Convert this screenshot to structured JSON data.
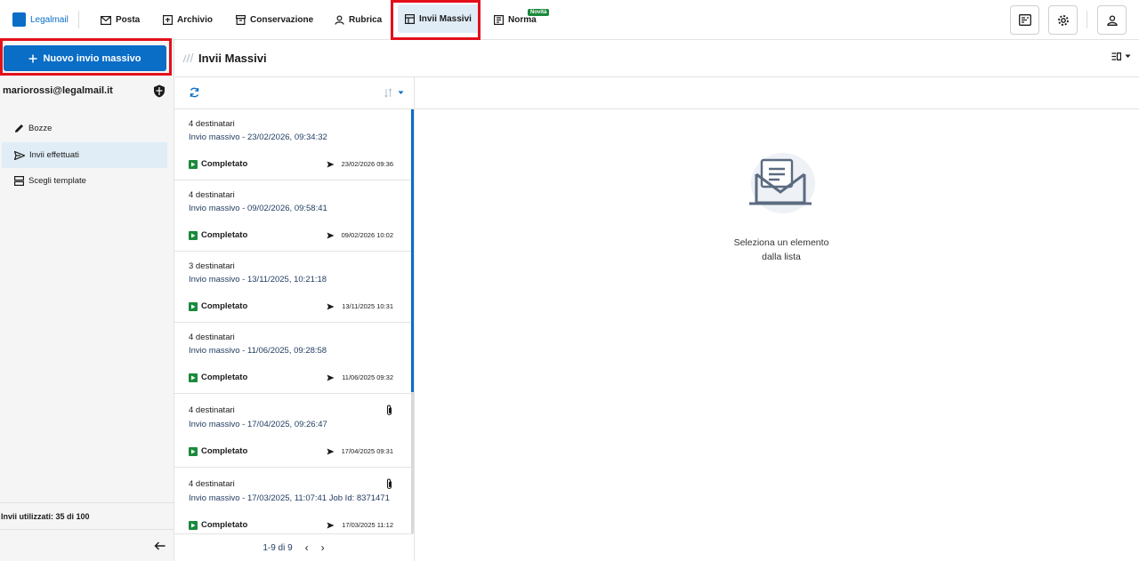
{
  "topnav": {
    "logo_label": "Legalmail",
    "items": [
      {
        "label": "Posta",
        "icon": "mail-icon"
      },
      {
        "label": "Archivio",
        "icon": "archive-icon"
      },
      {
        "label": "Conservazione",
        "icon": "storage-icon"
      },
      {
        "label": "Rubrica",
        "icon": "contacts-icon"
      },
      {
        "label": "Invii Massivi",
        "icon": "bulk-send-icon",
        "active": true
      },
      {
        "label": "Norma",
        "icon": "norma-icon"
      }
    ],
    "new_badge": "Novità"
  },
  "sidebar": {
    "new_button": "Nuovo invio massivo",
    "account": "mariorossi@legalmail.it",
    "items": [
      {
        "label": "Bozze",
        "icon": "pencil-icon"
      },
      {
        "label": "Invii effettuati",
        "icon": "send-icon",
        "active": true
      },
      {
        "label": "Scegli template",
        "icon": "template-icon"
      }
    ],
    "usage": "Invii utilizzati: 35 di 100"
  },
  "main": {
    "title": "Invii Massivi",
    "empty_line1": "Seleziona un elemento",
    "empty_line2": "dalla lista"
  },
  "list": {
    "status_label": "Completato",
    "items": [
      {
        "recipients": "4 destinatari",
        "subject": "Invio massivo - 23/02/2026, 09:34:32",
        "sent": "23/02/2026 09:36",
        "attachment": false
      },
      {
        "recipients": "4 destinatari",
        "subject": "Invio massivo - 09/02/2026, 09:58:41",
        "sent": "09/02/2026 10:02",
        "attachment": false
      },
      {
        "recipients": "3 destinatari",
        "subject": "Invio massivo - 13/11/2025, 10:21:18",
        "sent": "13/11/2025 10:31",
        "attachment": false
      },
      {
        "recipients": "4 destinatari",
        "subject": "Invio massivo - 11/06/2025, 09:28:58",
        "sent": "11/06/2025 09:32",
        "attachment": false
      },
      {
        "recipients": "4 destinatari",
        "subject": "Invio massivo - 17/04/2025, 09:26:47",
        "sent": "17/04/2025 09:31",
        "attachment": true
      },
      {
        "recipients": "4 destinatari",
        "subject": "Invio massivo - 17/03/2025, 11:07:41 Job Id: 8371471",
        "sent": "17/03/2025 11:12",
        "attachment": true
      }
    ],
    "pager": "1-9 di 9"
  },
  "colors": {
    "primary": "#0a6dc6",
    "status_green": "#1a8a3c",
    "highlight": "#e3101c"
  }
}
